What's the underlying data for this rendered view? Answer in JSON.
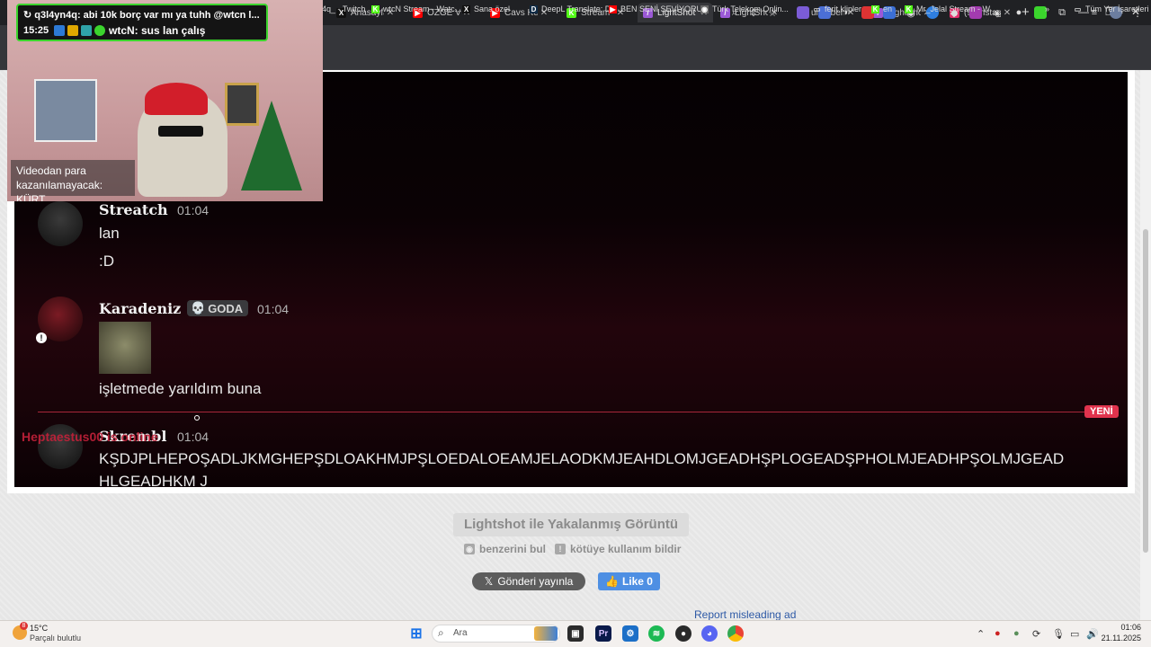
{
  "tabs": [
    {
      "label": "SUBWAY S",
      "icon_color": "#3a3a3a",
      "glyph": ""
    },
    {
      "label": "Anasayfa /",
      "icon_color": "#111111",
      "glyph": "X"
    },
    {
      "label": "ÖZGE VE E",
      "icon_color": "#ff0000",
      "glyph": "▶"
    },
    {
      "label": "Cavs Kesit",
      "icon_color": "#ff0000",
      "glyph": "▶"
    },
    {
      "label": "Stream - K",
      "icon_color": "#53fc18",
      "glyph": "K"
    },
    {
      "label": "LightShot",
      "icon_color": "#9b59d6",
      "glyph": "/"
    },
    {
      "label": "LightShot",
      "icon_color": "#9b59d6",
      "glyph": "/"
    },
    {
      "label": "ulan benim",
      "icon_color": "#ff0000",
      "glyph": "▶"
    },
    {
      "label": "LightShot",
      "icon_color": "#9b59d6",
      "glyph": "/"
    },
    {
      "label": "(9) Instagr",
      "icon_color": "#e1306c",
      "glyph": "◎"
    }
  ],
  "bookmarks": [
    {
      "label": "4q_ - Twitch",
      "icon_color": "",
      "glyph": ""
    },
    {
      "label": "wtcN Stream - Watc...",
      "icon_color": "#53fc18",
      "glyph": "K"
    },
    {
      "label": "Sana özel",
      "icon_color": "#111111",
      "glyph": "X"
    },
    {
      "label": "DeepL Translate: Dü...",
      "icon_color": "#0f2b46",
      "glyph": "D"
    },
    {
      "label": "BEN SENİ SEVİYORU...",
      "icon_color": "#ff0000",
      "glyph": "▶"
    },
    {
      "label": "Türk Telekom Onlin...",
      "icon_color": "#666666",
      "glyph": "◉"
    },
    {
      "label": "ferit klipler",
      "icon_color": "",
      "glyph": "▭"
    },
    {
      "label": "en",
      "icon_color": "#53fc18",
      "glyph": "K"
    },
    {
      "label": "Mr_Jelal Stream - W...",
      "icon_color": "#53fc18",
      "glyph": "K"
    },
    {
      "label": "Tüm Yer İşaretleri",
      "icon_color": "",
      "glyph": "▭"
    }
  ],
  "overlay": {
    "chat_line_1": "↻ q3l4yn4q: abi 10k borç var mı ya tuhh @wtcn l...",
    "time": "15:25",
    "chat_line_2": "wtcN: sus lan çalış",
    "caption_1": "Videodan para",
    "caption_2": "kazanılamayacak: KÜRT"
  },
  "messages": {
    "m1": {
      "name": "Streatch",
      "time": "01:04",
      "lines": [
        "lan",
        ":D"
      ]
    },
    "m2": {
      "name": "Karadeniz",
      "badge": "GODA",
      "time": "01:04",
      "text": "işletmede yarıldım buna"
    },
    "new_marker": "YENİ",
    "m3": {
      "name": "Skrembl",
      "overlap_name": "Heptaestus00 is online",
      "time": "01:04",
      "text": "KŞDJPLHEPOŞADLJKMGHEPŞDLOAKHMJPŞLOEDALOEAMJELAODKMJEAHDLOMJGEADHŞPLOGEADŞPHOLMJEADHPŞOLMJGEAD",
      "text2": "HLGEADHKM J"
    }
  },
  "lightshot": {
    "title": "Lightshot ile Yakalanmış Görüntü",
    "find_similar": "benzerini bul",
    "report_abuse": "kötüye kullanım bildir",
    "post_button": "Gönderi yayınla",
    "like_button": "Like 0",
    "report_ad": "Report misleading ad"
  },
  "taskbar": {
    "weather_temp": "15°C",
    "weather_desc": "Parçalı bulutlu",
    "search_placeholder": "Ara",
    "clock_time": "01:06",
    "clock_date": "21.11.2025",
    "notif_count": "8"
  }
}
